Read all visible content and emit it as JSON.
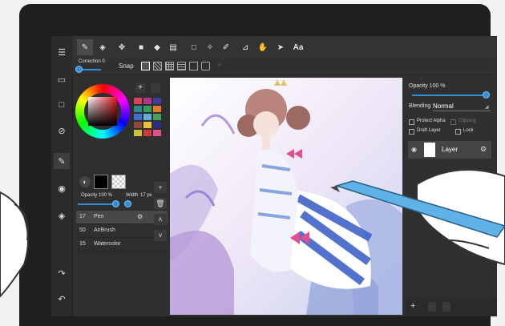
{
  "toolbar": {
    "tools": [
      {
        "name": "pen-tool",
        "glyph": "✎"
      },
      {
        "name": "eraser-tool",
        "glyph": "◈"
      },
      {
        "name": "move-tool",
        "glyph": "✥"
      },
      {
        "name": "shape-tool",
        "glyph": "■"
      },
      {
        "name": "fill-tool",
        "glyph": "◆"
      },
      {
        "name": "gradient-tool",
        "glyph": "▤"
      },
      {
        "name": "select-rect-tool",
        "glyph": "□"
      },
      {
        "name": "magic-wand-tool",
        "glyph": "✧"
      },
      {
        "name": "select-pen-tool",
        "glyph": "✐"
      },
      {
        "name": "transform-tool",
        "glyph": "⊿"
      },
      {
        "name": "hand-tool",
        "glyph": "✋"
      },
      {
        "name": "pointer-tool",
        "glyph": "➤"
      }
    ],
    "text_tool_label": "Aa"
  },
  "subbar": {
    "correction_label": "Correction 0",
    "correction_value": 0,
    "snap_label": "Snap"
  },
  "left_rail": {
    "icons": [
      "menu-icon",
      "file-icon",
      "canvas-icon",
      "rotate-icon",
      "brush-icon",
      "palette-icon",
      "layers-icon",
      "redo-icon",
      "undo-icon"
    ]
  },
  "color_panel": {
    "add_label": "+",
    "primary_color": "#000000",
    "secondary_color": "#ffffff",
    "swatches": [
      "#d9425a",
      "#b0348c",
      "#3f3f9a",
      "#2e8a8f",
      "#3a9e5b",
      "#e87a2c",
      "#3c6fd1",
      "#60b0d4",
      "#46a05c",
      "#8c4a3b",
      "#e8c23a",
      "#2d2d86",
      "#c8c33a",
      "#d13b3b",
      "#e04f8f"
    ],
    "opacity_label": "Opacity 100 %",
    "opacity_value": 1.0,
    "width_label": "Width",
    "width_value": "17 px"
  },
  "brushes": [
    {
      "size": "17",
      "name": "Pen",
      "active": true
    },
    {
      "size": "50",
      "name": "AirBrush",
      "active": false
    },
    {
      "size": "15",
      "name": "Watercolor",
      "active": false
    }
  ],
  "mid_tools": {
    "add": "+",
    "delete": "🗑",
    "up": "˄",
    "down": "˅"
  },
  "layer_panel": {
    "opacity_label": "Opacity 100 %",
    "opacity_value": 1.0,
    "blending_label": "Blending",
    "blending_value": "Normal",
    "protect_alpha": "Protect Alpha",
    "clipping": "Clipping",
    "draft_layer": "Draft Layer",
    "lock": "Lock",
    "layer_name": "Layer",
    "bottom_add": "+"
  },
  "colors": {
    "accent": "#2f8fd8",
    "background": "#2f2f2f"
  }
}
